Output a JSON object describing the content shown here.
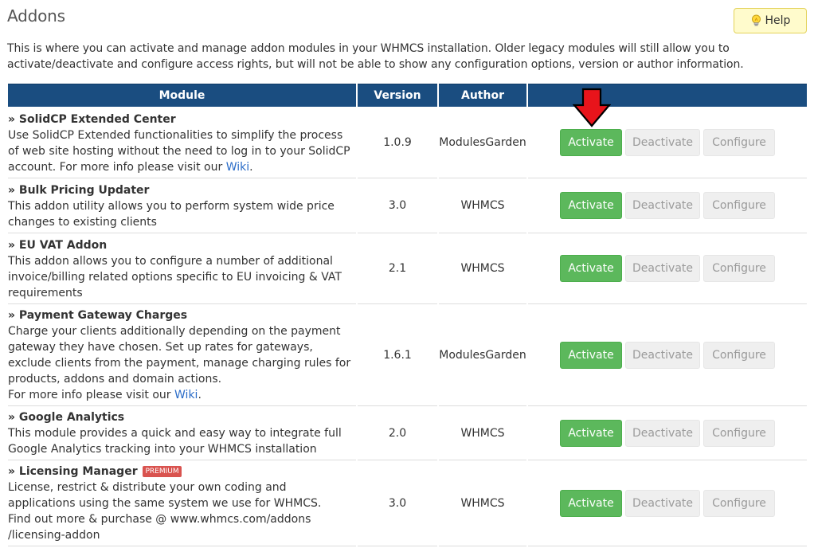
{
  "page": {
    "title": "Addons",
    "help_label": "Help",
    "intro": "This is where you can activate and manage addon modules in your WHMCS installation. Older legacy modules will still allow you to activate/deactivate and configure access rights, but will not be able to show any configuration options, version or author information."
  },
  "table": {
    "headers": {
      "module": "Module",
      "version": "Version",
      "author": "Author",
      "actions": ""
    },
    "activate_label": "Activate",
    "deactivate_label": "Deactivate",
    "configure_label": "Configure",
    "rows": [
      {
        "name": "» SolidCP Extended Center",
        "description": "Use SolidCP Extended functionalities to simplify the process of web site hosting without the need to log in to your SolidCP account. For more info please visit our ",
        "link": "Wiki",
        "after_link": ".",
        "version": "1.0.9",
        "author": "ModulesGarden"
      },
      {
        "name": "» Bulk Pricing Updater",
        "description": "This addon utility allows you to perform system wide price changes to existing clients",
        "version": "3.0",
        "author": "WHMCS"
      },
      {
        "name": "» EU VAT Addon",
        "description": "This addon allows you to configure a number of additional invoice/billing related options specific to EU invoicing & VAT requirements",
        "version": "2.1",
        "author": "WHMCS"
      },
      {
        "name": "» Payment Gateway Charges",
        "description": "Charge your clients additionally depending on the payment gateway they have chosen. Set up rates for gateways, exclude clients from the payment, manage charging rules for products, addons and domain actions.",
        "extra_line": "For more info please visit our ",
        "link": "Wiki",
        "after_link": ".",
        "version": "1.6.1",
        "author": "ModulesGarden"
      },
      {
        "name": "» Google Analytics",
        "description": "This module provides a quick and easy way to integrate full Google Analytics tracking into your WHMCS installation",
        "version": "2.0",
        "author": "WHMCS"
      },
      {
        "name": "» Licensing Manager",
        "badge": "PREMIUM",
        "description": "License, restrict & distribute your own coding and applications using the same system we use for WHMCS.",
        "extra_line": "Find out more & purchase @ www.whmcs.com/addons /licensing-addon",
        "version": "3.0",
        "author": "WHMCS"
      }
    ]
  },
  "icons": {
    "help": "lightbulb-icon",
    "pointer": "red-down-arrow-icon"
  },
  "colors": {
    "header_bg": "#1a4d80",
    "activate_bg": "#5cb85c",
    "help_bg": "#fffbcc",
    "badge_bg": "#d9534f",
    "link": "#2a6cc8",
    "arrow": "#e8141b"
  }
}
